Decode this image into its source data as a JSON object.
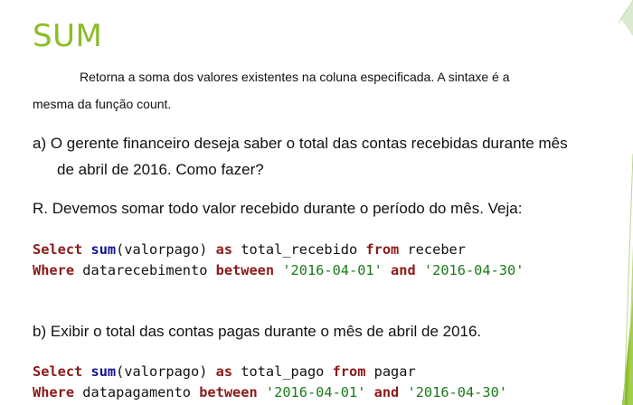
{
  "title": "SUM",
  "intro": {
    "line1": "Retorna a soma dos valores existentes na coluna especificada. A sintaxe é a",
    "line2": "mesma da função count."
  },
  "question_a": {
    "marker": "a)",
    "line1": "O gerente financeiro deseja saber o total das contas recebidas durante mês",
    "line2": "de abril de 2016. Como fazer?"
  },
  "answer_a": "R. Devemos somar todo valor recebido durante o período do mês. Veja:",
  "code_a": {
    "line1": {
      "k1": "Select",
      "fn": "sum",
      "t1": "(valorpago) ",
      "k2": "as",
      "t2": " total_recebido ",
      "k3": "from",
      "t3": " receber"
    },
    "line2": {
      "k1": "Where",
      "t1": " datarecebimento ",
      "k2": "between",
      "s1": "'2016-04-01'",
      "k3": "and",
      "s2": "'2016-04-30'"
    }
  },
  "question_b": {
    "marker": "b)",
    "text": "Exibir o total das contas pagas durante o mês de abril de 2016."
  },
  "code_b": {
    "line1": {
      "k1": "Select",
      "fn": "sum",
      "t1": "(valorpago) ",
      "k2": "as",
      "t2": " total_pago ",
      "k3": "from",
      "t3": " pagar"
    },
    "line2": {
      "k1": "Where",
      "t1": " datapagamento ",
      "k2": "between",
      "s1": "'2016-04-01'",
      "k3": "and",
      "s2": "'2016-04-30'"
    }
  },
  "colors": {
    "title": "#8bbd28",
    "keyword": "#8b1a1a",
    "function": "#17148c",
    "string": "#1a7a1a",
    "accent_deco": "#8bbd28"
  }
}
